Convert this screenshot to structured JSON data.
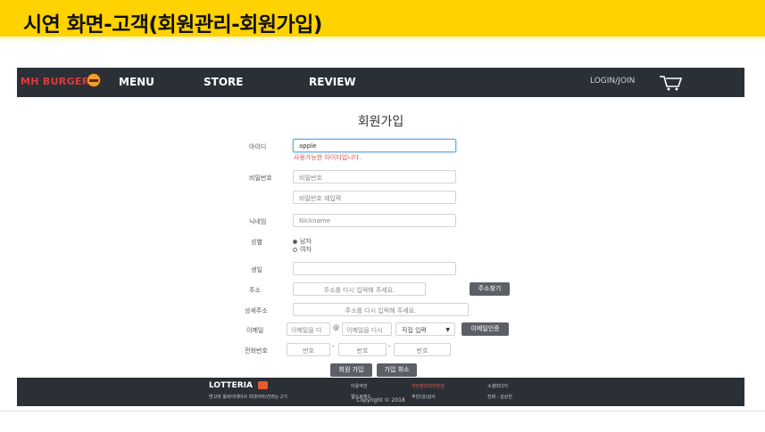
{
  "slide": {
    "title": "시연 화면-고객(회원관리-회원가입)",
    "banner_color": "#ffd200"
  },
  "navbar": {
    "brand": "MH BURGER",
    "brand_icon": "burger-icon",
    "items": [
      "MENU",
      "STORE",
      "REVIEW"
    ],
    "login": "LOGIN/JOIN",
    "cart_icon": "cart-icon",
    "bg_color": "#2b2f36"
  },
  "form": {
    "title": "회원가입",
    "id": {
      "label": "아이디",
      "value": "apple",
      "message": "사용가능한 아이디입니다."
    },
    "password": {
      "label": "비밀번호",
      "placeholder": "비밀번호",
      "confirm_placeholder": "비밀번호 재입력"
    },
    "nickname": {
      "label": "닉네임",
      "placeholder": "Nickname"
    },
    "gender": {
      "label": "성별",
      "options": [
        "남자",
        "여자"
      ],
      "selected": "남자"
    },
    "birthday": {
      "label": "생일",
      "value": ""
    },
    "address": {
      "label": "주소",
      "placeholder": "주소를 다시 입력해 주세요.",
      "search_button": "주소찾기"
    },
    "address_detail": {
      "label": "상세주소",
      "placeholder": "주소를 다시 입력해 주세요."
    },
    "email": {
      "label": "이메일",
      "local_placeholder": "이메일을 다",
      "at": "@",
      "domain_placeholder": "이메일을 다시",
      "select_value": "직접 입력",
      "verify_button": "이메일인증"
    },
    "phone": {
      "label": "전화번호",
      "part_placeholder": "번호",
      "separator": "-"
    },
    "submit_button": "회원 가입",
    "cancel_button": "가입 취소"
  },
  "footer": {
    "logo": "LOTTERIA",
    "address": "연고마 롤레이데이사 미대아아/선려는 2기",
    "links": [
      "이용약관",
      "개인정보처리방침",
      "소셜미디어"
    ],
    "row2": [
      "웹오로케드",
      "주민(강)상사",
      "전화 : 김상천"
    ],
    "copyright": "Copyright © 2018"
  }
}
